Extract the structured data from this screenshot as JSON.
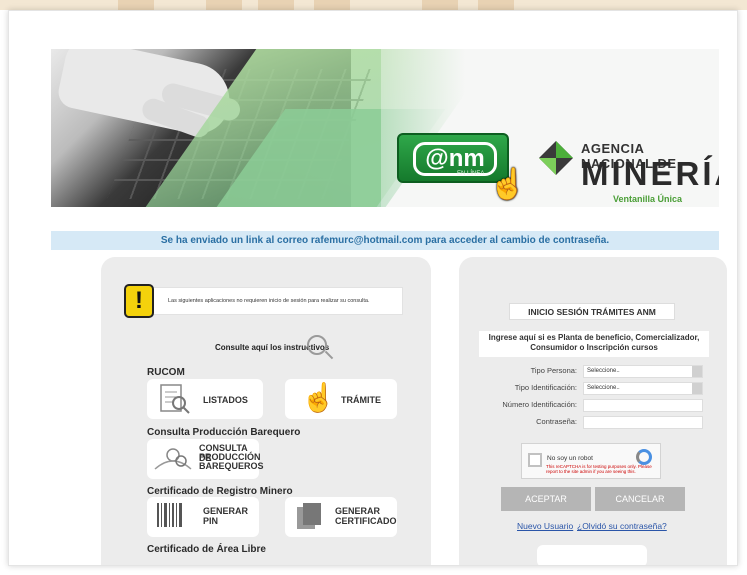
{
  "banner": {
    "anm_logo": "@nm",
    "anm_sub": "EN LÍNEA",
    "agency_line1": "AGENCIA NACIONAL DE",
    "agency_line2": "MINERÍA",
    "agency_line3": "Ventanilla Única"
  },
  "notice": "Se ha enviado un link al correo rafemurc@hotmail.com para acceder al cambio de contraseña.",
  "left": {
    "warning": "Las siguientes aplicaciones no requieren inicio de sesión para realizar su consulta.",
    "consulte": "Consulte aquí los instructivos",
    "rucom_title": "RUCOM",
    "listados": "LISTADOS",
    "tramite": "TRÁMITE",
    "produccion_title": "Consulta Producción Barequero",
    "consulta_barequeros": [
      "CONSULTA DE",
      "PRODUCCIÓN",
      "BAREQUEROS"
    ],
    "certificado_title": "Certificado de Registro Minero",
    "generar_pin": [
      "GENERAR",
      "PIN"
    ],
    "generar_certificado": [
      "GENERAR",
      "CERTIFICADO"
    ],
    "area_libre_title": "Certificado de Área Libre"
  },
  "right": {
    "login_title": "INICIO SESIÓN TRÁMITES ANM",
    "login_desc": "Ingrese aquí si es Planta de beneficio, Comercializador, Consumidor o Inscripción cursos",
    "tipo_persona_label": "Tipo Persona:",
    "tipo_persona_value": "Seleccione..",
    "tipo_id_label": "Tipo Identificación:",
    "tipo_id_value": "Seleccione..",
    "numero_id_label": "Número Identificación:",
    "contrasena_label": "Contraseña:",
    "captcha_text": "No soy un robot",
    "captcha_warning": "This reCAPTCHA is for testing purposes only. Please report to the site admin if you are seeing this.",
    "accept_label": "ACEPTAR",
    "cancel_label": "CANCELAR",
    "new_user_link": "Nuevo Usuario",
    "forgot_link": "¿Olvidó su contraseña?"
  },
  "colors": {
    "notice_bg": "#d6e9f6",
    "notice_text": "#2a6fa3",
    "anm_green": "#1f8f3a",
    "warning_yellow": "#f4d20c",
    "button_gray": "#b5b5b5",
    "link_blue": "#2a55a8"
  }
}
